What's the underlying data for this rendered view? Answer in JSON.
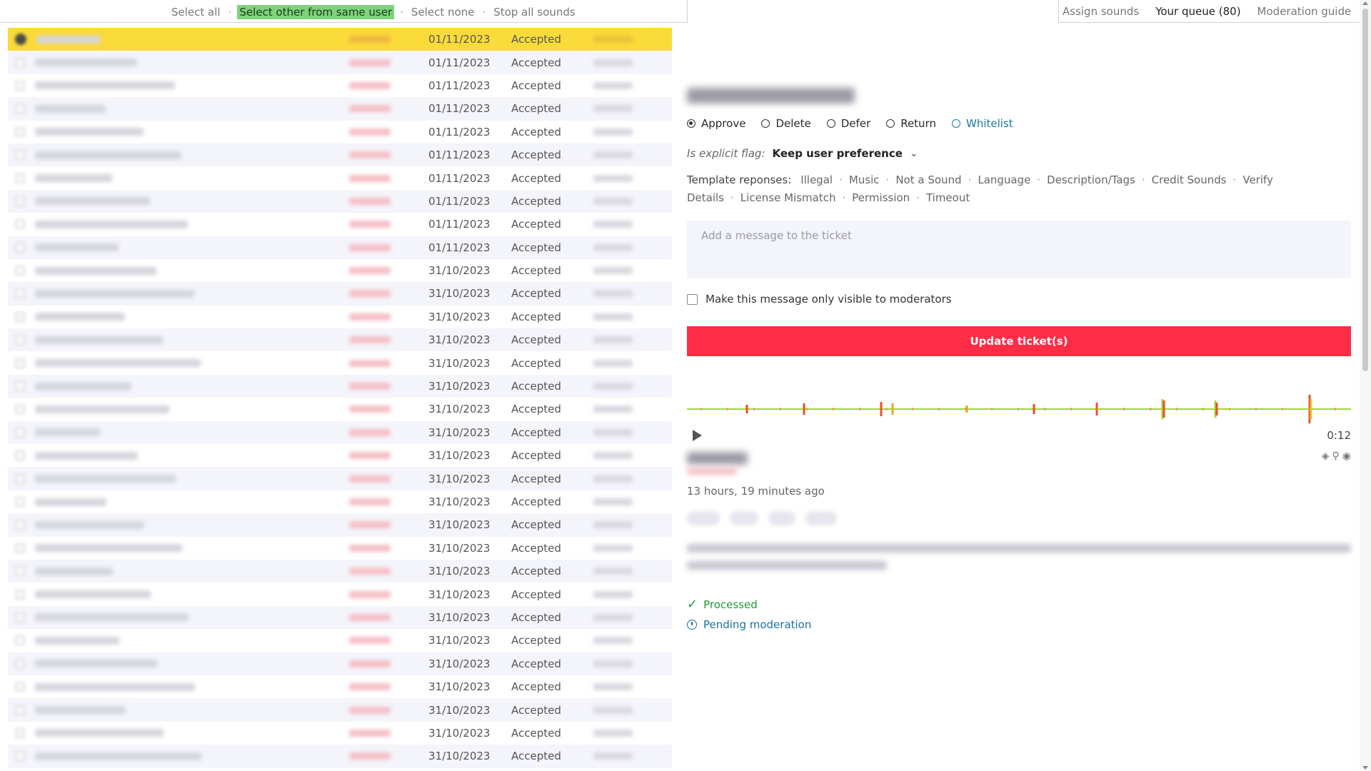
{
  "left_toolbar": {
    "select_all": "Select all",
    "select_other": "Select other from same user",
    "select_none": "Select none",
    "stop_sounds": "Stop all sounds",
    "separator": "·"
  },
  "right_tabs": {
    "assign": "Assign sounds",
    "queue": "Your queue (80)",
    "guide": "Moderation guide"
  },
  "tickets": [
    {
      "date": "01/11/2023",
      "status": "Accepted",
      "selected": true
    },
    {
      "date": "01/11/2023",
      "status": "Accepted"
    },
    {
      "date": "01/11/2023",
      "status": "Accepted"
    },
    {
      "date": "01/11/2023",
      "status": "Accepted"
    },
    {
      "date": "01/11/2023",
      "status": "Accepted"
    },
    {
      "date": "01/11/2023",
      "status": "Accepted"
    },
    {
      "date": "01/11/2023",
      "status": "Accepted"
    },
    {
      "date": "01/11/2023",
      "status": "Accepted"
    },
    {
      "date": "01/11/2023",
      "status": "Accepted"
    },
    {
      "date": "01/11/2023",
      "status": "Accepted"
    },
    {
      "date": "31/10/2023",
      "status": "Accepted"
    },
    {
      "date": "31/10/2023",
      "status": "Accepted"
    },
    {
      "date": "31/10/2023",
      "status": "Accepted"
    },
    {
      "date": "31/10/2023",
      "status": "Accepted"
    },
    {
      "date": "31/10/2023",
      "status": "Accepted"
    },
    {
      "date": "31/10/2023",
      "status": "Accepted"
    },
    {
      "date": "31/10/2023",
      "status": "Accepted"
    },
    {
      "date": "31/10/2023",
      "status": "Accepted"
    },
    {
      "date": "31/10/2023",
      "status": "Accepted"
    },
    {
      "date": "31/10/2023",
      "status": "Accepted"
    },
    {
      "date": "31/10/2023",
      "status": "Accepted"
    },
    {
      "date": "31/10/2023",
      "status": "Accepted"
    },
    {
      "date": "31/10/2023",
      "status": "Accepted"
    },
    {
      "date": "31/10/2023",
      "status": "Accepted"
    },
    {
      "date": "31/10/2023",
      "status": "Accepted"
    },
    {
      "date": "31/10/2023",
      "status": "Accepted"
    },
    {
      "date": "31/10/2023",
      "status": "Accepted"
    },
    {
      "date": "31/10/2023",
      "status": "Accepted"
    },
    {
      "date": "31/10/2023",
      "status": "Accepted"
    },
    {
      "date": "31/10/2023",
      "status": "Accepted"
    },
    {
      "date": "31/10/2023",
      "status": "Accepted"
    },
    {
      "date": "31/10/2023",
      "status": "Accepted"
    }
  ],
  "moderation": {
    "actions": [
      {
        "label": "Approve",
        "checked": true
      },
      {
        "label": "Delete"
      },
      {
        "label": "Defer"
      },
      {
        "label": "Return"
      },
      {
        "label": "Whitelist",
        "accent": true
      }
    ],
    "explicit_label": "Is explicit flag:",
    "explicit_value": "Keep user preference",
    "templates_label": "Template reponses:",
    "templates": [
      "Illegal",
      "Music",
      "Not a Sound",
      "Language",
      "Description/Tags",
      "Credit Sounds",
      "Verify Details",
      "License Mismatch",
      "Permission",
      "Timeout"
    ],
    "message_placeholder": "Add a message to the ticket",
    "moderators_only_label": "Make this message only visible to moderators",
    "update_button": "Update ticket(s)"
  },
  "sound": {
    "duration": "0:12",
    "time_ago": "13 hours, 19 minutes ago",
    "status_processed": "Processed",
    "status_pending": "Pending moderation"
  },
  "colors": {
    "selected_row": "#fbdb3a",
    "highlight": "#7ed37a",
    "update_button": "#ff2c45",
    "processed": "#1e9a38",
    "pending": "#1a6fa8"
  }
}
